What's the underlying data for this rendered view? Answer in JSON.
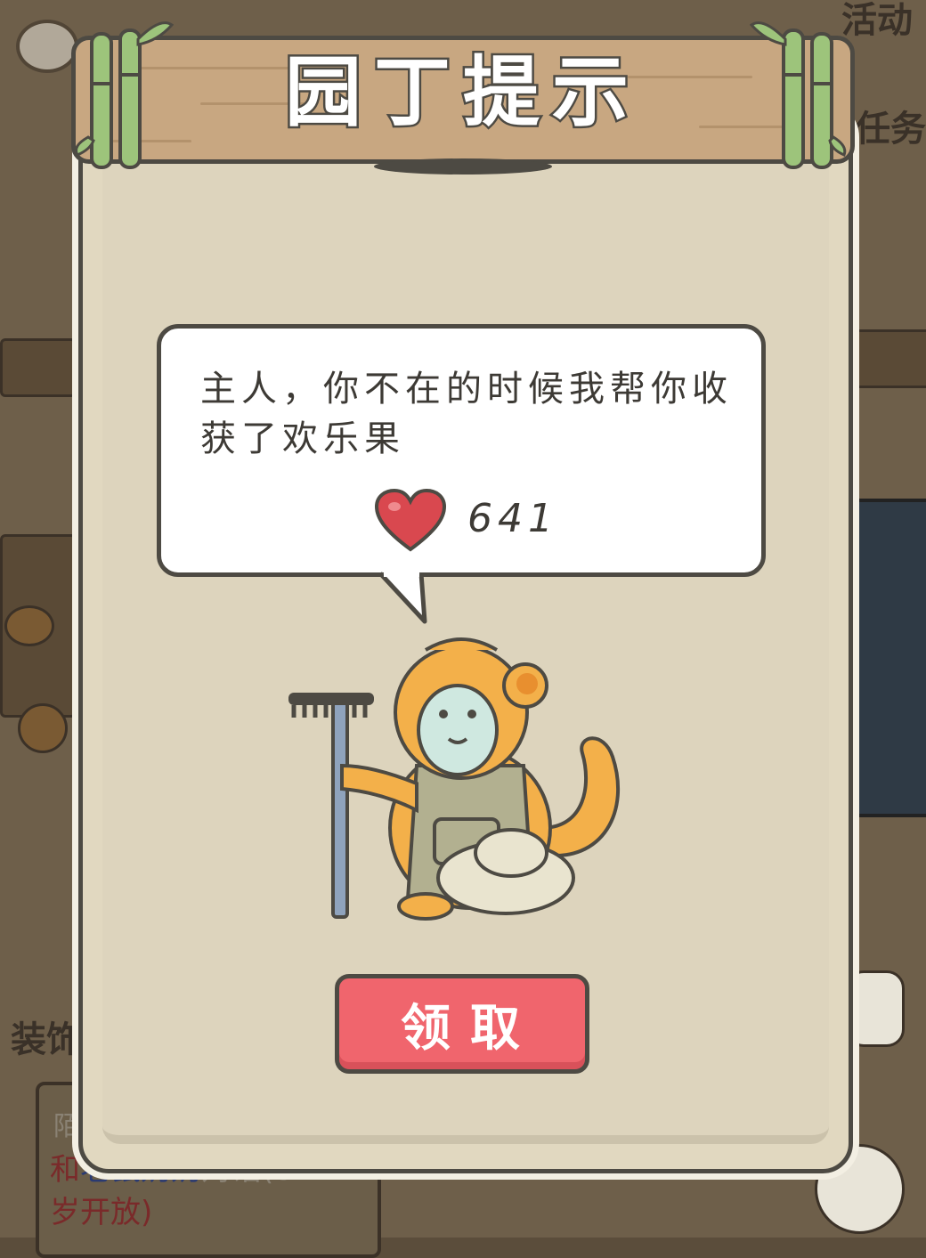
{
  "dialog": {
    "title": "园丁提示",
    "message": "主人，你不在的时候我帮你收获了欢乐果",
    "reward": {
      "icon": "heart-icon",
      "count": "641"
    },
    "claim_label": "领取"
  },
  "background": {
    "decor_label": "装饰",
    "task_label": "任务",
    "activity_label": "活动",
    "quest_tag": "陌",
    "quest_text_prefix": "和",
    "quest_text_name": "老鼠奶奶",
    "quest_text_action": "对话(8",
    "quest_text_line2": "岁开放)"
  },
  "colors": {
    "panel": "#e1d8c0",
    "board": "#c8a781",
    "button": "#f0656d",
    "outline": "#4d4a43",
    "heart": "#d9484f"
  }
}
